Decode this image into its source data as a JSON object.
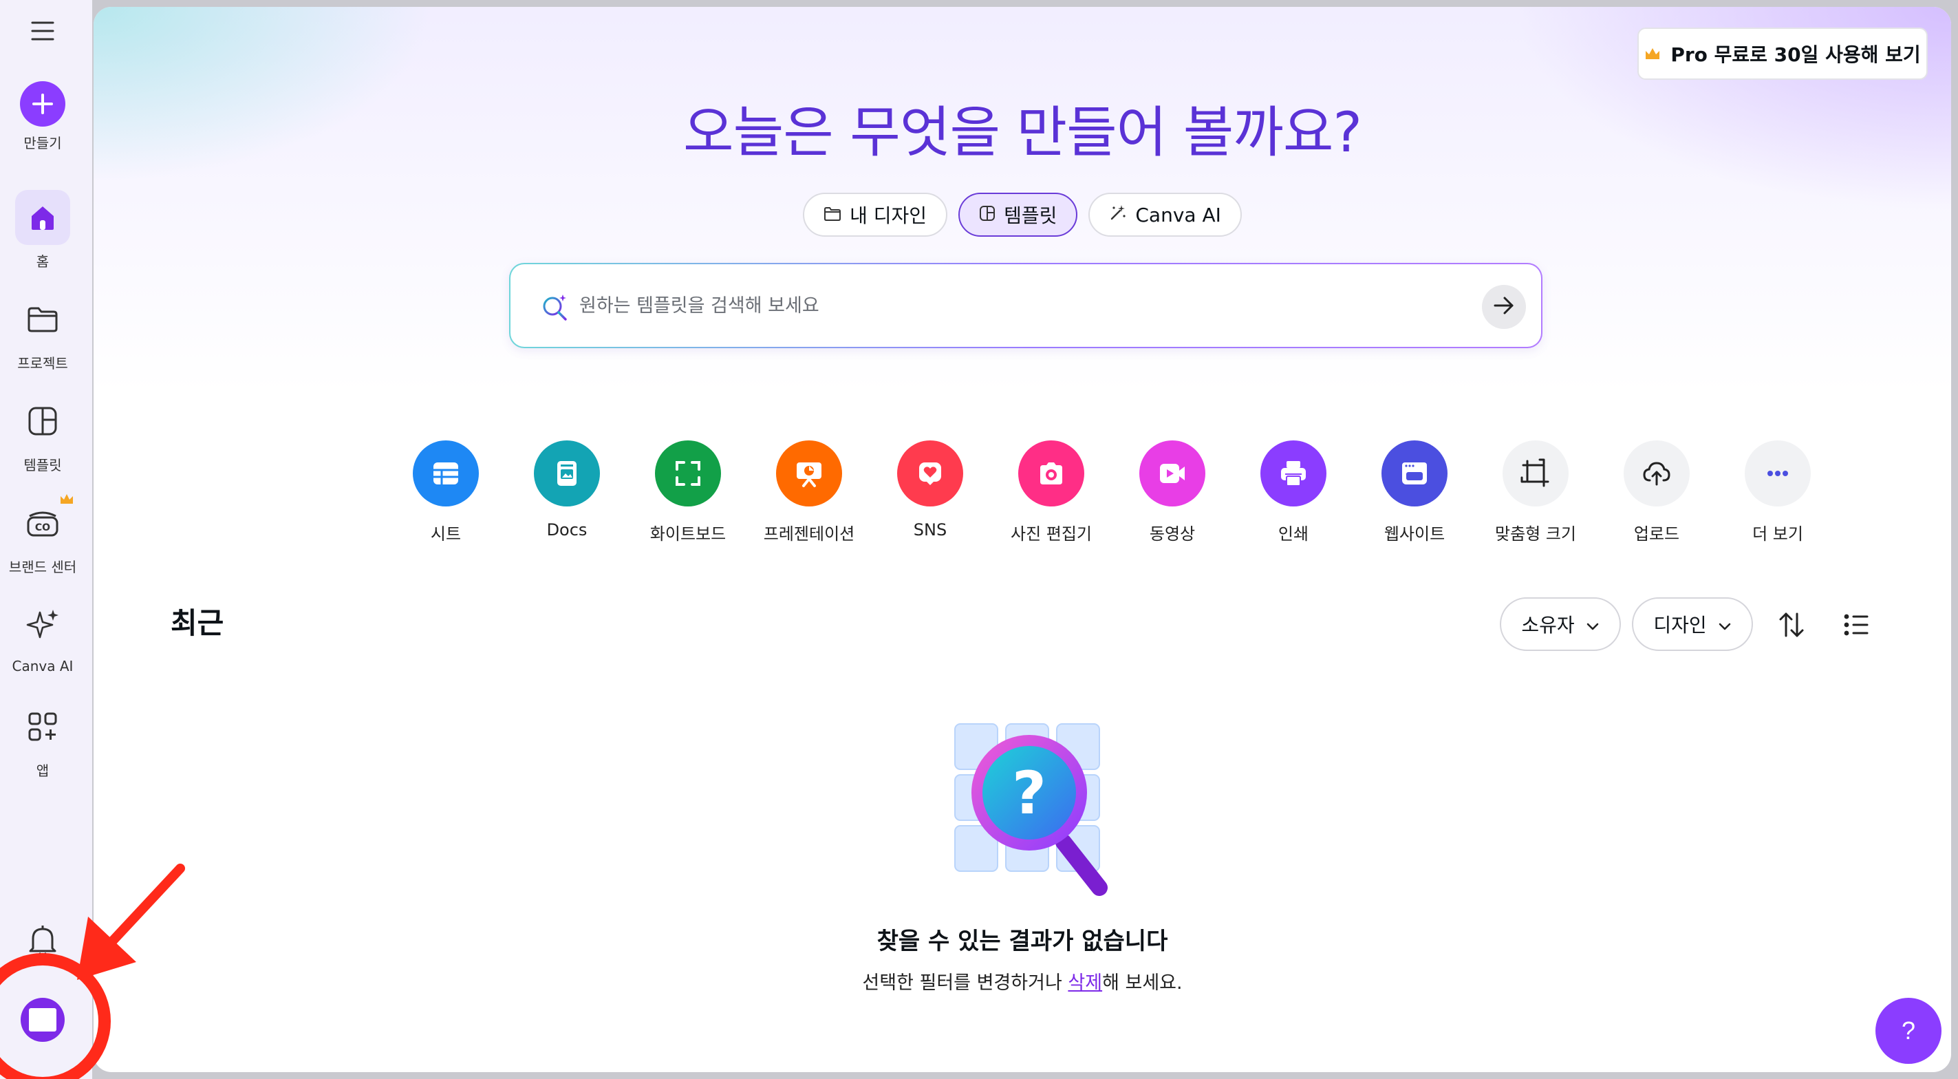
{
  "sidebar": {
    "create_label": "만들기",
    "items": [
      {
        "label": "홈"
      },
      {
        "label": "프로젝트"
      },
      {
        "label": "템플릿"
      },
      {
        "label": "브랜드 센터"
      },
      {
        "label": "Canva AI"
      },
      {
        "label": "앱"
      }
    ]
  },
  "header": {
    "pro_button": "Pro 무료로 30일 사용해 보기"
  },
  "hero": {
    "title": "오늘은 무엇을 만들어 볼까요?",
    "tabs": [
      {
        "label": "내 디자인"
      },
      {
        "label": "템플릿"
      },
      {
        "label": "Canva AI"
      }
    ],
    "search_placeholder": "원하는 템플릿을 검색해 보세요"
  },
  "shortcuts": [
    {
      "label": "시트",
      "color": "#1e88f4",
      "icon": "sheet-icon"
    },
    {
      "label": "Docs",
      "color": "#13a4b4",
      "icon": "docs-icon"
    },
    {
      "label": "화이트보드",
      "color": "#12a048",
      "icon": "whiteboard-icon"
    },
    {
      "label": "프레젠테이션",
      "color": "#ff6a00",
      "icon": "presentation-icon"
    },
    {
      "label": "SNS",
      "color": "#ff3b4e",
      "icon": "heart-icon"
    },
    {
      "label": "사진 편집기",
      "color": "#ff2e86",
      "icon": "camera-icon"
    },
    {
      "label": "동영상",
      "color": "#e83ee6",
      "icon": "video-icon"
    },
    {
      "label": "인쇄",
      "color": "#8b3dff",
      "icon": "printer-icon"
    },
    {
      "label": "웹사이트",
      "color": "#4b4fe0",
      "icon": "website-icon"
    },
    {
      "label": "맞춤형 크기",
      "color": "#f1f2f4",
      "icon": "resize-icon"
    },
    {
      "label": "업로드",
      "color": "#f1f2f4",
      "icon": "upload-icon"
    },
    {
      "label": "더 보기",
      "color": "#f1f2f4",
      "icon": "more-icon"
    }
  ],
  "recent": {
    "title": "최근",
    "filter_owner": "소유자",
    "filter_design": "디자인",
    "empty_title": "찾을 수 있는 결과가 없습니다",
    "empty_sub_before": "선택한 필터를 변경하거나 ",
    "empty_sub_link": "삭제",
    "empty_sub_after": "해 보세요."
  },
  "help_label": "?",
  "colors": {
    "brand_purple": "#8b3dff",
    "title_purple": "#5a32d6",
    "annotation_red": "#ff2a1a"
  }
}
